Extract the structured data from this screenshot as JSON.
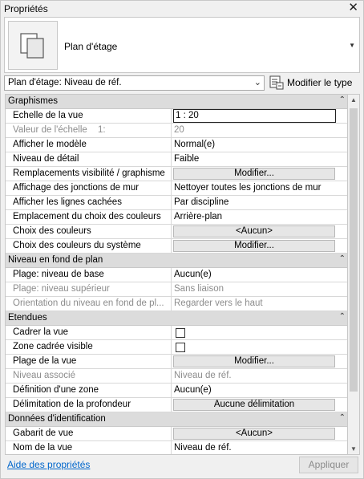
{
  "window": {
    "title": "Propriétés"
  },
  "type_selector": {
    "name": "Plan d'étage"
  },
  "view_selector": {
    "value": "Plan d'étage: Niveau de réf."
  },
  "edit_type": {
    "label": "Modifier le type"
  },
  "sections": [
    {
      "label": "Graphismes"
    },
    {
      "label": "Niveau en fond de plan"
    },
    {
      "label": "Etendues"
    },
    {
      "label": "Données d'identification"
    }
  ],
  "rows": {
    "echelle": {
      "name": "Echelle de la vue",
      "value": "1 : 20"
    },
    "valeur_echelle": {
      "name": "Valeur de l'échelle",
      "extra": "1:",
      "value": "20"
    },
    "afficher_modele": {
      "name": "Afficher le modèle",
      "value": "Normal(e)"
    },
    "niveau_detail": {
      "name": "Niveau de détail",
      "value": "Faible"
    },
    "remplacements": {
      "name": "Remplacements visibilité / graphisme",
      "value": "Modifier..."
    },
    "affichage_jonctions": {
      "name": "Affichage des jonctions de mur",
      "value": "Nettoyer toutes les jonctions de mur"
    },
    "lignes_cachees": {
      "name": "Afficher les lignes cachées",
      "value": "Par discipline"
    },
    "emplacement_couleurs": {
      "name": "Emplacement du choix des couleurs",
      "value": "Arrière-plan"
    },
    "choix_couleurs": {
      "name": "Choix des couleurs",
      "value": "<Aucun>"
    },
    "choix_couleurs_systeme": {
      "name": "Choix des couleurs du système",
      "value": "Modifier..."
    },
    "plage_base": {
      "name": "Plage: niveau de base",
      "value": "Aucun(e)"
    },
    "plage_sup": {
      "name": "Plage: niveau supérieur",
      "value": "Sans liaison"
    },
    "orientation": {
      "name": "Orientation du niveau en fond de pl...",
      "value": "Regarder vers le haut"
    },
    "cadrer": {
      "name": "Cadrer la vue"
    },
    "zone_cadree": {
      "name": "Zone cadrée visible"
    },
    "plage_vue": {
      "name": "Plage de la vue",
      "value": "Modifier..."
    },
    "niveau_associe": {
      "name": "Niveau associé",
      "value": "Niveau de réf."
    },
    "definition_zone": {
      "name": "Définition d'une zone",
      "value": "Aucun(e)"
    },
    "delimitation": {
      "name": "Délimitation de la profondeur",
      "value": "Aucune délimitation"
    },
    "gabarit": {
      "name": "Gabarit de vue",
      "value": "<Aucun>"
    },
    "nom_vue": {
      "name": "Nom de la vue",
      "value": "Niveau de réf."
    }
  },
  "footer": {
    "help_link": "Aide des propriétés",
    "apply_label": "Appliquer"
  },
  "icons": {
    "close": "close-icon",
    "collapse": "collapse-up-icon",
    "view_type": "floor-plan-icon",
    "edit_type": "edit-type-icon"
  },
  "colors": {
    "link": "#0066cc",
    "section_bg": "#dcdcdc",
    "disabled_text": "#8c8c8c"
  }
}
